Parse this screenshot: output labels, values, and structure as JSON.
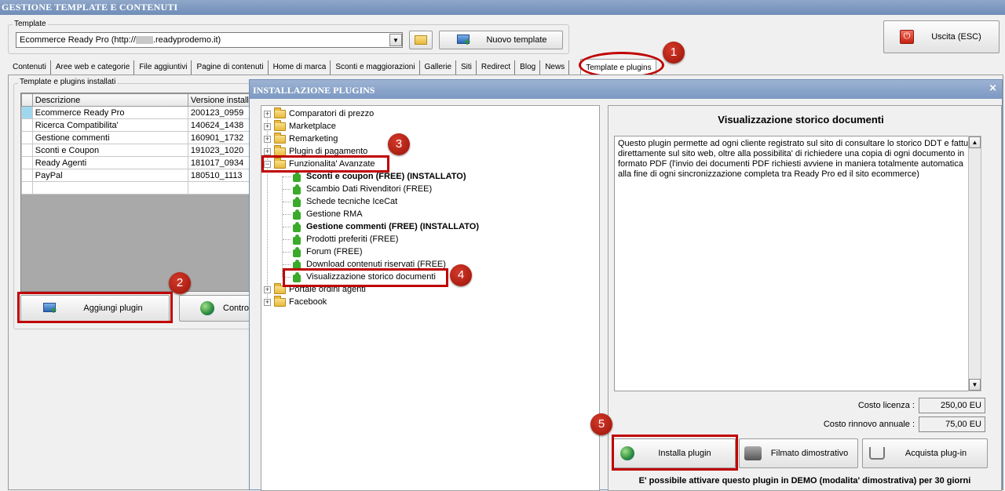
{
  "window": {
    "title": "GESTIONE TEMPLATE E CONTENUTI",
    "close": "×"
  },
  "template_group": {
    "label": "Template",
    "selected": "Ecommerce Ready Pro (http://",
    "selected_tail": ".readyprodemo.it)",
    "new_template_label": "Nuovo template"
  },
  "exit_button": {
    "label": "Uscita (ESC)"
  },
  "tabs": [
    "Contenuti",
    "Aree web e categorie",
    "File aggiuntivi",
    "Pagine di contenuti",
    "Home di marca",
    "Sconti e maggiorazioni",
    "Gallerie",
    "Siti",
    "Redirect",
    "Blog",
    "News",
    "Template e plugins"
  ],
  "installed": {
    "group_label": "Template e plugins installati",
    "columns": [
      "Descrizione",
      "Versione installa"
    ],
    "rows": [
      [
        "Ecommerce Ready Pro",
        "200123_0959"
      ],
      [
        "Ricerca Compatibilita'",
        "140624_1438"
      ],
      [
        "Gestione commenti",
        "160901_1732"
      ],
      [
        "Sconti e Coupon",
        "191023_1020"
      ],
      [
        "Ready Agenti",
        "181017_0934"
      ],
      [
        "PayPal",
        "180510_1113"
      ]
    ],
    "add_plugin_label": "Aggiungi plugin",
    "control_label": "Contro"
  },
  "dialog": {
    "title": "INSTALLAZIONE PLUGINS",
    "close": "×",
    "tree": {
      "folders_top": [
        "Comparatori di prezzo",
        "Marketplace",
        "Remarketing",
        "Plugin di pagamento"
      ],
      "open_folder": "Funzionalita' Avanzate",
      "children": [
        "Sconti e coupon (FREE) (INSTALLATO)",
        "Scambio Dati Rivenditori (FREE)",
        "Schede tecniche IceCat",
        "Gestione RMA",
        "Gestione commenti (FREE) (INSTALLATO)",
        "Prodotti preferiti (FREE)",
        "Forum (FREE)",
        "Download contenuti riservati (FREE)",
        "Visualizzazione storico documenti"
      ],
      "folders_bottom": [
        "Portale ordini agenti",
        "Facebook"
      ]
    },
    "detail": {
      "title": "Visualizzazione storico documenti",
      "description": "Questo plugin permette ad ogni cliente registrato sul sito di consultare lo storico DDT e fatture direttamente sul sito web, oltre alla possibilita' di richiedere una copia di ogni documento in formato PDF (l'invio dei documenti PDF richiesti avviene in maniera totalmente automatica alla fine di ogni sincronizzazione completa tra Ready Pro ed il sito ecommerce)",
      "license_label": "Costo licenza :",
      "license_value": "250,00 EU",
      "renewal_label": "Costo rinnovo annuale :",
      "renewal_value": "75,00 EU",
      "install_label": "Installa plugin",
      "video_label": "Filmato dimostrativo",
      "buy_label": "Acquista plug-in",
      "demo_note": "E' possibile attivare questo plugin in DEMO (modalita' dimostrativa) per 30 giorni"
    }
  },
  "badges": [
    "1",
    "2",
    "3",
    "4",
    "5"
  ],
  "colors": {
    "annotation_red": "#c00000",
    "titlebar": "#7b98c2"
  }
}
